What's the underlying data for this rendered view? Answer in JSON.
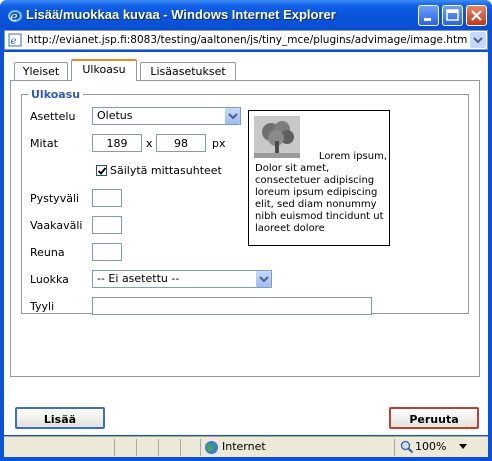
{
  "window": {
    "title": "Lisää/muokkaa kuvaa - Windows Internet Explorer",
    "address": "http://evianet.jsp.fi:8083/testing/aaltonen/js/tiny_mce/plugins/advimage/image.htm"
  },
  "tabs": [
    {
      "label": "Yleiset",
      "active": false
    },
    {
      "label": "Ulkoasu",
      "active": true
    },
    {
      "label": "Lisäasetukset",
      "active": false
    }
  ],
  "fieldset": {
    "legend": "Ulkoasu",
    "asettelu_label": "Asettelu",
    "asettelu_value": "Oletus",
    "mitat_label": "Mitat",
    "width_value": "189",
    "times": "x",
    "height_value": "98",
    "unit": "px",
    "keep_ratio_label": "Säilytä mittasuhteet",
    "keep_ratio_checked": true,
    "vspace_label": "Pystyväli",
    "hspace_label": "Vaakaväli",
    "border_label": "Reuna",
    "class_label": "Luokka",
    "class_value": "-- Ei asetettu --",
    "style_label": "Tyyli"
  },
  "preview": {
    "text_first": "Lorem ipsum,",
    "text_rest": "Dolor sit amet, consectetuer adipiscing loreum ipsum edipiscing elit, sed diam nonummy nibh euismod tincidunt ut laoreet dolore"
  },
  "buttons": {
    "insert": "Lisää",
    "cancel": "Peruuta"
  },
  "status": {
    "zone": "Internet",
    "zoom": "100%"
  },
  "colors": {
    "titlebar": "#0a53d8",
    "legend": "#2b5bb8",
    "active_tab_accent": "#e68b2c"
  }
}
